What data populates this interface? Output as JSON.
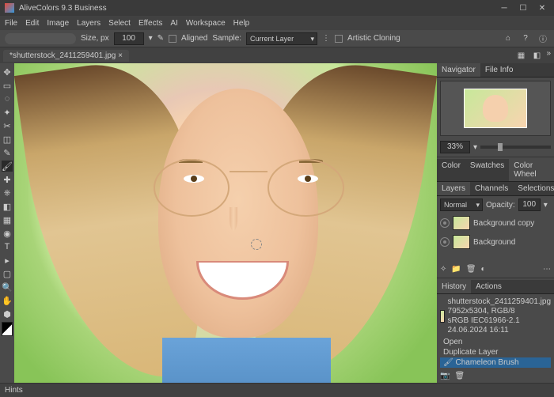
{
  "titlebar": {
    "app_title": "AliveColors 9.3  Business"
  },
  "menubar": {
    "items": [
      "File",
      "Edit",
      "Image",
      "Layers",
      "Select",
      "Effects",
      "AI",
      "Workspace",
      "Help"
    ]
  },
  "options": {
    "size_label": "Size, px",
    "size_value": "100",
    "aligned_label": "Aligned",
    "sample_label": "Sample:",
    "sample_value": "Current Layer",
    "artistic_label": "Artistic Cloning"
  },
  "document": {
    "tab_title": "*shutterstock_2411259401.jpg"
  },
  "navigator": {
    "tab1": "Navigator",
    "tab2": "File Info",
    "zoom": "33%"
  },
  "palette_tabs1": {
    "t1": "Color",
    "t2": "Swatches",
    "t3": "Color Wheel"
  },
  "layers_panel": {
    "tab1": "Layers",
    "tab2": "Channels",
    "tab3": "Selections",
    "blend": "Normal",
    "opacity_label": "Opacity:",
    "opacity_value": "100",
    "layer1": "Background copy",
    "layer2": "Background"
  },
  "history_panel": {
    "tab1": "History",
    "tab2": "Actions",
    "file_name": "shutterstock_2411259401.jpg",
    "file_dims": "7952x5304, RGB/8",
    "file_profile": "sRGB IEC61966-2.1",
    "file_date": "24.06.2024 16:11",
    "h1": "Open",
    "h2": "Duplicate Layer",
    "h3": "Chameleon Brush"
  },
  "statusbar": {
    "hints": "Hints"
  }
}
